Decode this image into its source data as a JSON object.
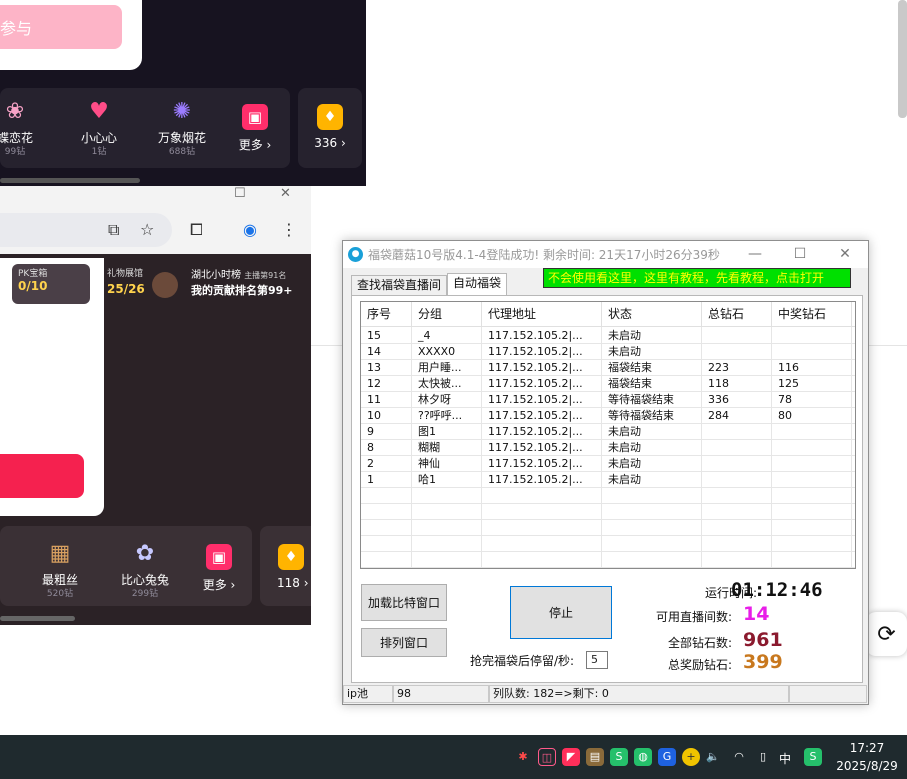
{
  "live_top": {
    "join_label": "参与",
    "gifts": [
      {
        "name": "蝶恋花",
        "price": "99钻",
        "icon": "flower-icon"
      },
      {
        "name": "小心心",
        "price": "1钻",
        "icon": "heart-icon"
      },
      {
        "name": "万象烟花",
        "price": "688钻",
        "icon": "firework-icon"
      }
    ],
    "more_label": "更多 ›",
    "ticket_value": "336 ›"
  },
  "browser": {
    "pk_label": "PK宝箱",
    "pk_count": "0/10",
    "gift_gallery_label": "礼物展馆",
    "gift_gallery_count": "25/26",
    "rank_title": "湖北小时榜",
    "rank_sub": "主播第91名",
    "rank_contrib": "我的贡献排名第99+",
    "gifts": [
      {
        "name": "最粗丝",
        "price": "520钻",
        "icon": "chest-icon"
      },
      {
        "name": "比心兔兔",
        "price": "299钻",
        "icon": "bunny-icon"
      }
    ],
    "more_label": "更多 ›",
    "ticket_value": "118 ›"
  },
  "tool": {
    "title": "福袋蘑菇10号版4.1-4登陆成功! 剩余时间: 21天17小时26分39秒",
    "tabs": [
      "查找福袋直播间",
      "自动福袋"
    ],
    "notice": "不会使用看这里，这里有教程，先看教程，点击打开",
    "columns": [
      "序号",
      "分组",
      "代理地址",
      "状态",
      "总钻石",
      "中奖钻石"
    ],
    "rows": [
      [
        "15",
        "_4",
        "117.152.105.2|...",
        "未启动",
        "",
        ""
      ],
      [
        "14",
        "XXXX0",
        "117.152.105.2|...",
        "未启动",
        "",
        ""
      ],
      [
        "13",
        "用户睡...",
        "117.152.105.2|...",
        "福袋结束",
        "223",
        "116"
      ],
      [
        "12",
        "太快被...",
        "117.152.105.2|...",
        "福袋结束",
        "118",
        "125"
      ],
      [
        "11",
        "林夕呀",
        "117.152.105.2|...",
        "等待福袋结束",
        "336",
        "78"
      ],
      [
        "10",
        "??呼呼...",
        "117.152.105.2|...",
        "等待福袋结束",
        "284",
        "80"
      ],
      [
        "9",
        "图1",
        "117.152.105.2|...",
        "未启动",
        "",
        ""
      ],
      [
        "8",
        "糊糊",
        "117.152.105.2|...",
        "未启动",
        "",
        ""
      ],
      [
        "2",
        "神仙",
        "117.152.105.2|...",
        "未启动",
        "",
        ""
      ],
      [
        "1",
        "哈1",
        "117.152.105.2|...",
        "未启动",
        "",
        ""
      ]
    ],
    "btn_load": "加载比特窗口",
    "btn_arrange": "排列窗口",
    "btn_stop": "停止",
    "stay_label": "抢完福袋后停留/秒:",
    "stay_value": "5",
    "stats": {
      "runtime_label": "运行时间:",
      "runtime_value": "01:12:46",
      "rooms_label": "可用直播间数:",
      "rooms_value": "14",
      "diamonds_label": "全部钻石数:",
      "diamonds_value": "961",
      "reward_label": "总奖励钻石:",
      "reward_value": "399"
    },
    "colors": {
      "rooms": "#e81ee8",
      "diamonds": "#8b1a2e",
      "reward": "#c8781e",
      "notice_bg": "#00e000",
      "notice_text": "#ffff00"
    },
    "statusbar": {
      "ip_label": "ip池",
      "ip_count": "98",
      "queue_text": "列队数: 182=>剩下: 0"
    }
  },
  "taskbar": {
    "lang": "中",
    "time": "17:27",
    "date": "2025/8/29"
  }
}
